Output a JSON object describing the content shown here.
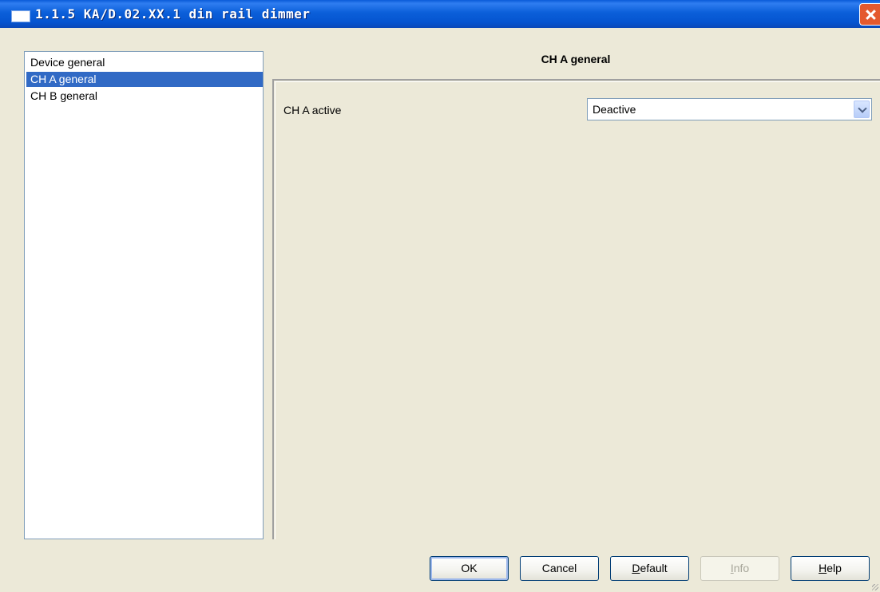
{
  "window": {
    "title": "1.1.5 KA/D.02.XX.1 din rail dimmer",
    "close_icon": "close-icon",
    "app_icon": "window-icon"
  },
  "nav": {
    "items": [
      {
        "label": "Device general",
        "selected": false
      },
      {
        "label": "CH A general",
        "selected": true
      },
      {
        "label": "CH B general",
        "selected": false
      }
    ]
  },
  "main": {
    "section_title": "CH A general",
    "params": [
      {
        "label": "CH A active",
        "value": "Deactive"
      }
    ]
  },
  "buttons": {
    "ok": {
      "label": "OK"
    },
    "cancel": {
      "label": "Cancel"
    },
    "default": {
      "first": "D",
      "rest": "efault"
    },
    "info": {
      "first": "I",
      "rest": "nfo"
    },
    "help": {
      "first": "H",
      "rest": "elp"
    }
  },
  "colors": {
    "titlebar": "#0554d0",
    "selection": "#316ac5",
    "background": "#ece9d8"
  }
}
